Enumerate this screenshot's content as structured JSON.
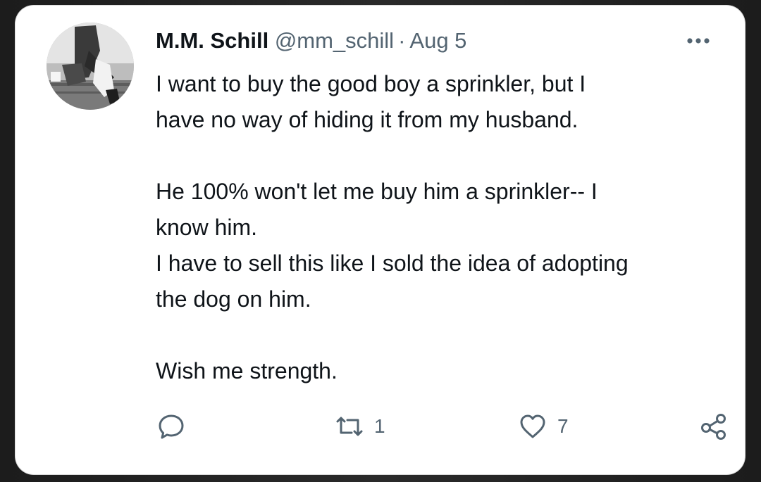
{
  "tweet": {
    "author_name": "M.M. Schill",
    "handle": "@mm_schill",
    "separator": "·",
    "date": "Aug 5",
    "more_icon": "more-horizontal-icon",
    "paragraphs": [
      "I want to buy the good boy a sprinkler, but I\nhave no way of hiding it from my husband.",
      "He 100% won't let me buy him a sprinkler-- I\nknow him.\nI have to sell this like I sold the idea of adopting\nthe dog on him.",
      "Wish me strength."
    ],
    "actions": {
      "reply_icon": "reply-icon",
      "retweet_icon": "retweet-icon",
      "retweet_count": "1",
      "like_icon": "heart-icon",
      "like_count": "7",
      "share_icon": "share-icon"
    }
  },
  "colors": {
    "text_primary": "#0f1419",
    "text_secondary": "#536471",
    "card_background": "#ffffff",
    "frame_background": "#1c1c1c"
  }
}
